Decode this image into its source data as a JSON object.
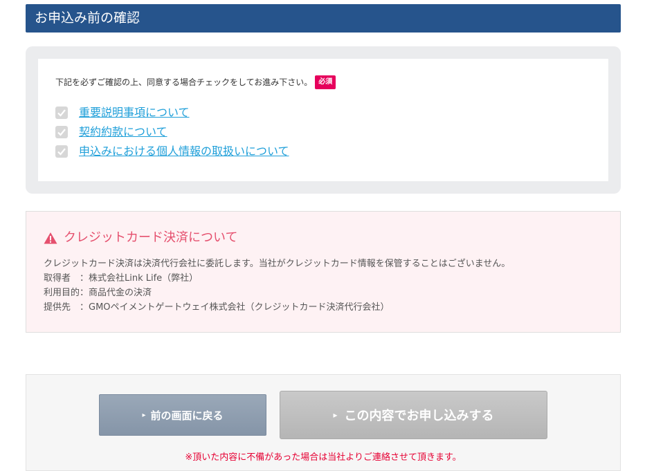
{
  "header": {
    "title": "お申込み前の確認"
  },
  "confirmation": {
    "instruction": "下記を必ずご確認の上、同意する場合チェックをしてお進み下さい。",
    "required_badge": "必須",
    "items": [
      {
        "label": "重要説明事項について",
        "checked": true
      },
      {
        "label": "契約約款について",
        "checked": true
      },
      {
        "label": "申込みにおける個人情報の取扱いについて",
        "checked": true
      }
    ]
  },
  "notice": {
    "icon": "warning-icon",
    "title": "クレジットカード決済について",
    "lines": [
      "クレジットカード決済は決済代行会社に委託します。当社がクレジットカード情報を保管することはございません。",
      "取得者　：株式会社Link Life（弊社）",
      "利用目的：商品代金の決済",
      "提供先　：GMOペイメントゲートウェイ株式会社（クレジットカード決済代行会社）"
    ]
  },
  "actions": {
    "back_label": "前の画面に戻る",
    "submit_label": "この内容でお申し込みする",
    "arrow_glyph": "▸",
    "note": "※頂いた内容に不備があった場合は当社よりご連絡させて頂きます。"
  },
  "colors": {
    "header_bg": "#26548c",
    "link": "#1f9fd9",
    "required_badge": "#e6005c",
    "notice_title": "#e5506e",
    "notice_bg": "#fef2f4",
    "back_button": "#8e9caf",
    "submit_button": "#bdbdbd",
    "note_text": "#e60033"
  }
}
